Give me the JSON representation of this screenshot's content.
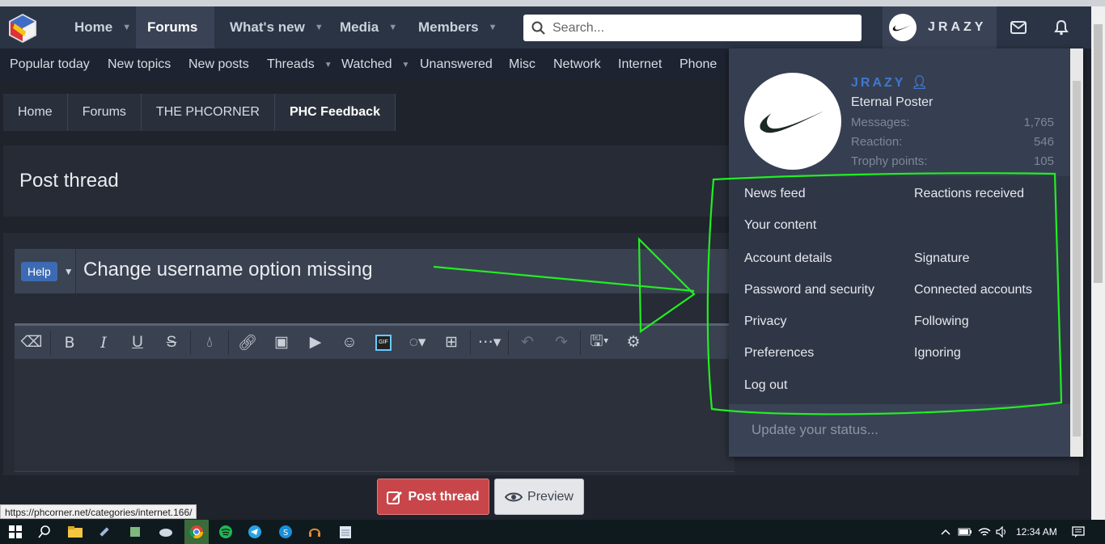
{
  "header": {
    "nav": [
      {
        "label": "Home",
        "caret": true
      },
      {
        "label": "Forums",
        "caret": false,
        "active": true
      },
      {
        "label": "What's new",
        "caret": true
      },
      {
        "label": "Media",
        "caret": true
      },
      {
        "label": "Members",
        "caret": true
      }
    ],
    "search_placeholder": "Search...",
    "username": "JRAZY"
  },
  "subnav": [
    {
      "label": "Popular today"
    },
    {
      "label": "New topics"
    },
    {
      "label": "New posts"
    },
    {
      "label": "Threads",
      "caret": true
    },
    {
      "label": "Watched",
      "caret": true
    },
    {
      "label": "Unanswered"
    },
    {
      "label": "Misc"
    },
    {
      "label": "Network"
    },
    {
      "label": "Internet"
    },
    {
      "label": "Phone"
    }
  ],
  "breadcrumb": [
    "Home",
    "Forums",
    "THE PHCORNER",
    "PHC Feedback"
  ],
  "page": {
    "title": "Post thread",
    "prefix": "Help",
    "thread_title": "Change username option missing"
  },
  "buttons": {
    "post": "Post thread",
    "preview": "Preview"
  },
  "status_url": "https://phcorner.net/categories/internet.166/",
  "account_menu": {
    "name": "JRAZY",
    "user_title": "Eternal Poster",
    "stats": [
      {
        "label": "Messages:",
        "value": "1,765"
      },
      {
        "label": "Reaction:",
        "value": "546"
      },
      {
        "label": "Trophy points:",
        "value": "105"
      }
    ],
    "links_left": [
      "News feed",
      "Your content",
      "Account details",
      "Password and security",
      "Privacy",
      "Preferences",
      "Log out"
    ],
    "links_right": [
      "Reactions received",
      "Signature",
      "Connected accounts",
      "Following",
      "Ignoring"
    ],
    "status_placeholder": "Update your status..."
  },
  "taskbar": {
    "time": "12:34 AM"
  },
  "colors": {
    "header_bg": "#2b3445",
    "annotation": "#22ee22",
    "post_button": "#c8464a",
    "username_accent": "#3f78d0"
  }
}
